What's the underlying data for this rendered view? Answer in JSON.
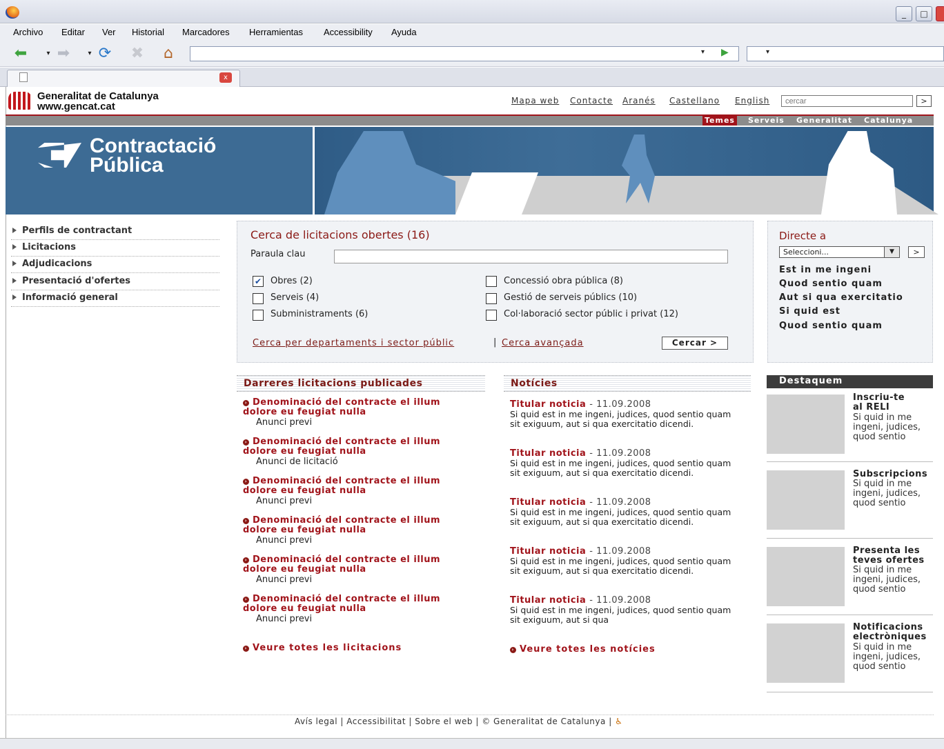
{
  "browser": {
    "menu": [
      "Archivo",
      "Editar",
      "Ver",
      "Historial",
      "Marcadores",
      "Herramientas",
      "Accessibility",
      "Ayuda"
    ],
    "win_min": "_",
    "win_max": "□",
    "tab_close": "x"
  },
  "header": {
    "org_name": "Generalitat de Catalunya",
    "org_url": "www.gencat.cat",
    "links": [
      "Mapa web",
      "Contacte",
      "Aranés",
      "Castellano",
      "English"
    ],
    "search_placeholder": "cercar",
    "search_go": ">",
    "categories": [
      "Temes",
      "Serveis",
      "Generalitat",
      "Catalunya"
    ]
  },
  "banner": {
    "title_line1": "Contractació",
    "title_line2": "Pública"
  },
  "leftnav": [
    "Perfils de contractant",
    "Licitacions",
    "Adjudicacions",
    "Presentació d'ofertes",
    "Informació general"
  ],
  "search": {
    "title": "Cerca de licitacions obertes (16)",
    "keyword_label": "Paraula clau",
    "keyword_value": "",
    "options_left": [
      {
        "label": "Obres (2)",
        "checked": true
      },
      {
        "label": "Serveis (4)",
        "checked": false
      },
      {
        "label": "Subministraments (6)",
        "checked": false
      }
    ],
    "options_right": [
      {
        "label": "Concessió obra pública (8)",
        "checked": false
      },
      {
        "label": "Gestió de serveis públics (10)",
        "checked": false
      },
      {
        "label": "Col·laboració sector públic i privat (12)",
        "checked": false
      }
    ],
    "dept_link": "Cerca per departaments i sector públic",
    "separator": "|",
    "advanced_link": "Cerca avançada",
    "button": "Cercar >"
  },
  "directe": {
    "title": "Directe a",
    "select_value": "Seleccioni...",
    "go": ">",
    "links": [
      "Est in me ingeni",
      "Quod sentio quam",
      "Aut si qua exercitatio",
      "Si quid est",
      "Quod sentio quam"
    ]
  },
  "licitacions": {
    "heading": "Darreres licitacions publicades",
    "items": [
      {
        "title": "Denominació del contracte el illum dolore eu feugiat nulla",
        "type": "Anunci previ"
      },
      {
        "title": "Denominació del contracte el illum dolore eu feugiat nulla",
        "type": "Anunci de licitació"
      },
      {
        "title": "Denominació del contracte el illum dolore eu feugiat nulla",
        "type": "Anunci previ"
      },
      {
        "title": "Denominació del contracte el illum dolore eu feugiat nulla",
        "type": "Anunci previ"
      },
      {
        "title": "Denominació del contracte el illum dolore eu feugiat nulla",
        "type": "Anunci previ"
      },
      {
        "title": "Denominació del contracte el illum dolore eu feugiat nulla",
        "type": "Anunci previ"
      }
    ],
    "more": "Veure totes les licitacions"
  },
  "noticies": {
    "heading": "Notícies",
    "items": [
      {
        "title": "Titular noticia",
        "date": "- 11.09.2008",
        "body": "Si quid est in me ingeni, judices, quod sentio quam sit exiguum, aut si qua exercitatio dicendi."
      },
      {
        "title": "Titular noticia",
        "date": "- 11.09.2008",
        "body": "Si quid est in me ingeni, judices, quod sentio quam sit exiguum, aut si qua exercitatio dicendi."
      },
      {
        "title": "Titular noticia",
        "date": "- 11.09.2008",
        "body": "Si quid est in me ingeni, judices, quod sentio quam sit exiguum, aut si qua exercitatio dicendi."
      },
      {
        "title": "Titular noticia",
        "date": "- 11.09.2008",
        "body": "Si quid est in me ingeni, judices, quod sentio quam sit exiguum, aut si qua exercitatio dicendi."
      },
      {
        "title": "Titular noticia",
        "date": "- 11.09.2008",
        "body": "Si quid est in me ingeni, judices, quod sentio quam sit exiguum, aut si qua"
      }
    ],
    "more": "Veure totes les notícies"
  },
  "destaquem": {
    "heading": "Destaquem",
    "items": [
      {
        "title": "Inscriu-te al RELI",
        "text": "Si quid in me ingeni, judices, quod sentio"
      },
      {
        "title": "Subscripcions",
        "text": "Si quid in me ingeni, judices, quod sentio"
      },
      {
        "title": "Presenta les teves ofertes",
        "text": "Si quid in me ingeni, judices, quod sentio"
      },
      {
        "title": "Notificacions electròniques",
        "text": "Si quid in me ingeni, judices, quod sentio"
      }
    ]
  },
  "footer": {
    "links": [
      "Avís legal",
      "Accessibilitat",
      "Sobre el web",
      "© Generalitat de Catalunya"
    ],
    "separator": "|"
  },
  "colors": {
    "accent": "#a1141b",
    "banner": "#3d6b94",
    "grey": "#8c8c8c"
  }
}
